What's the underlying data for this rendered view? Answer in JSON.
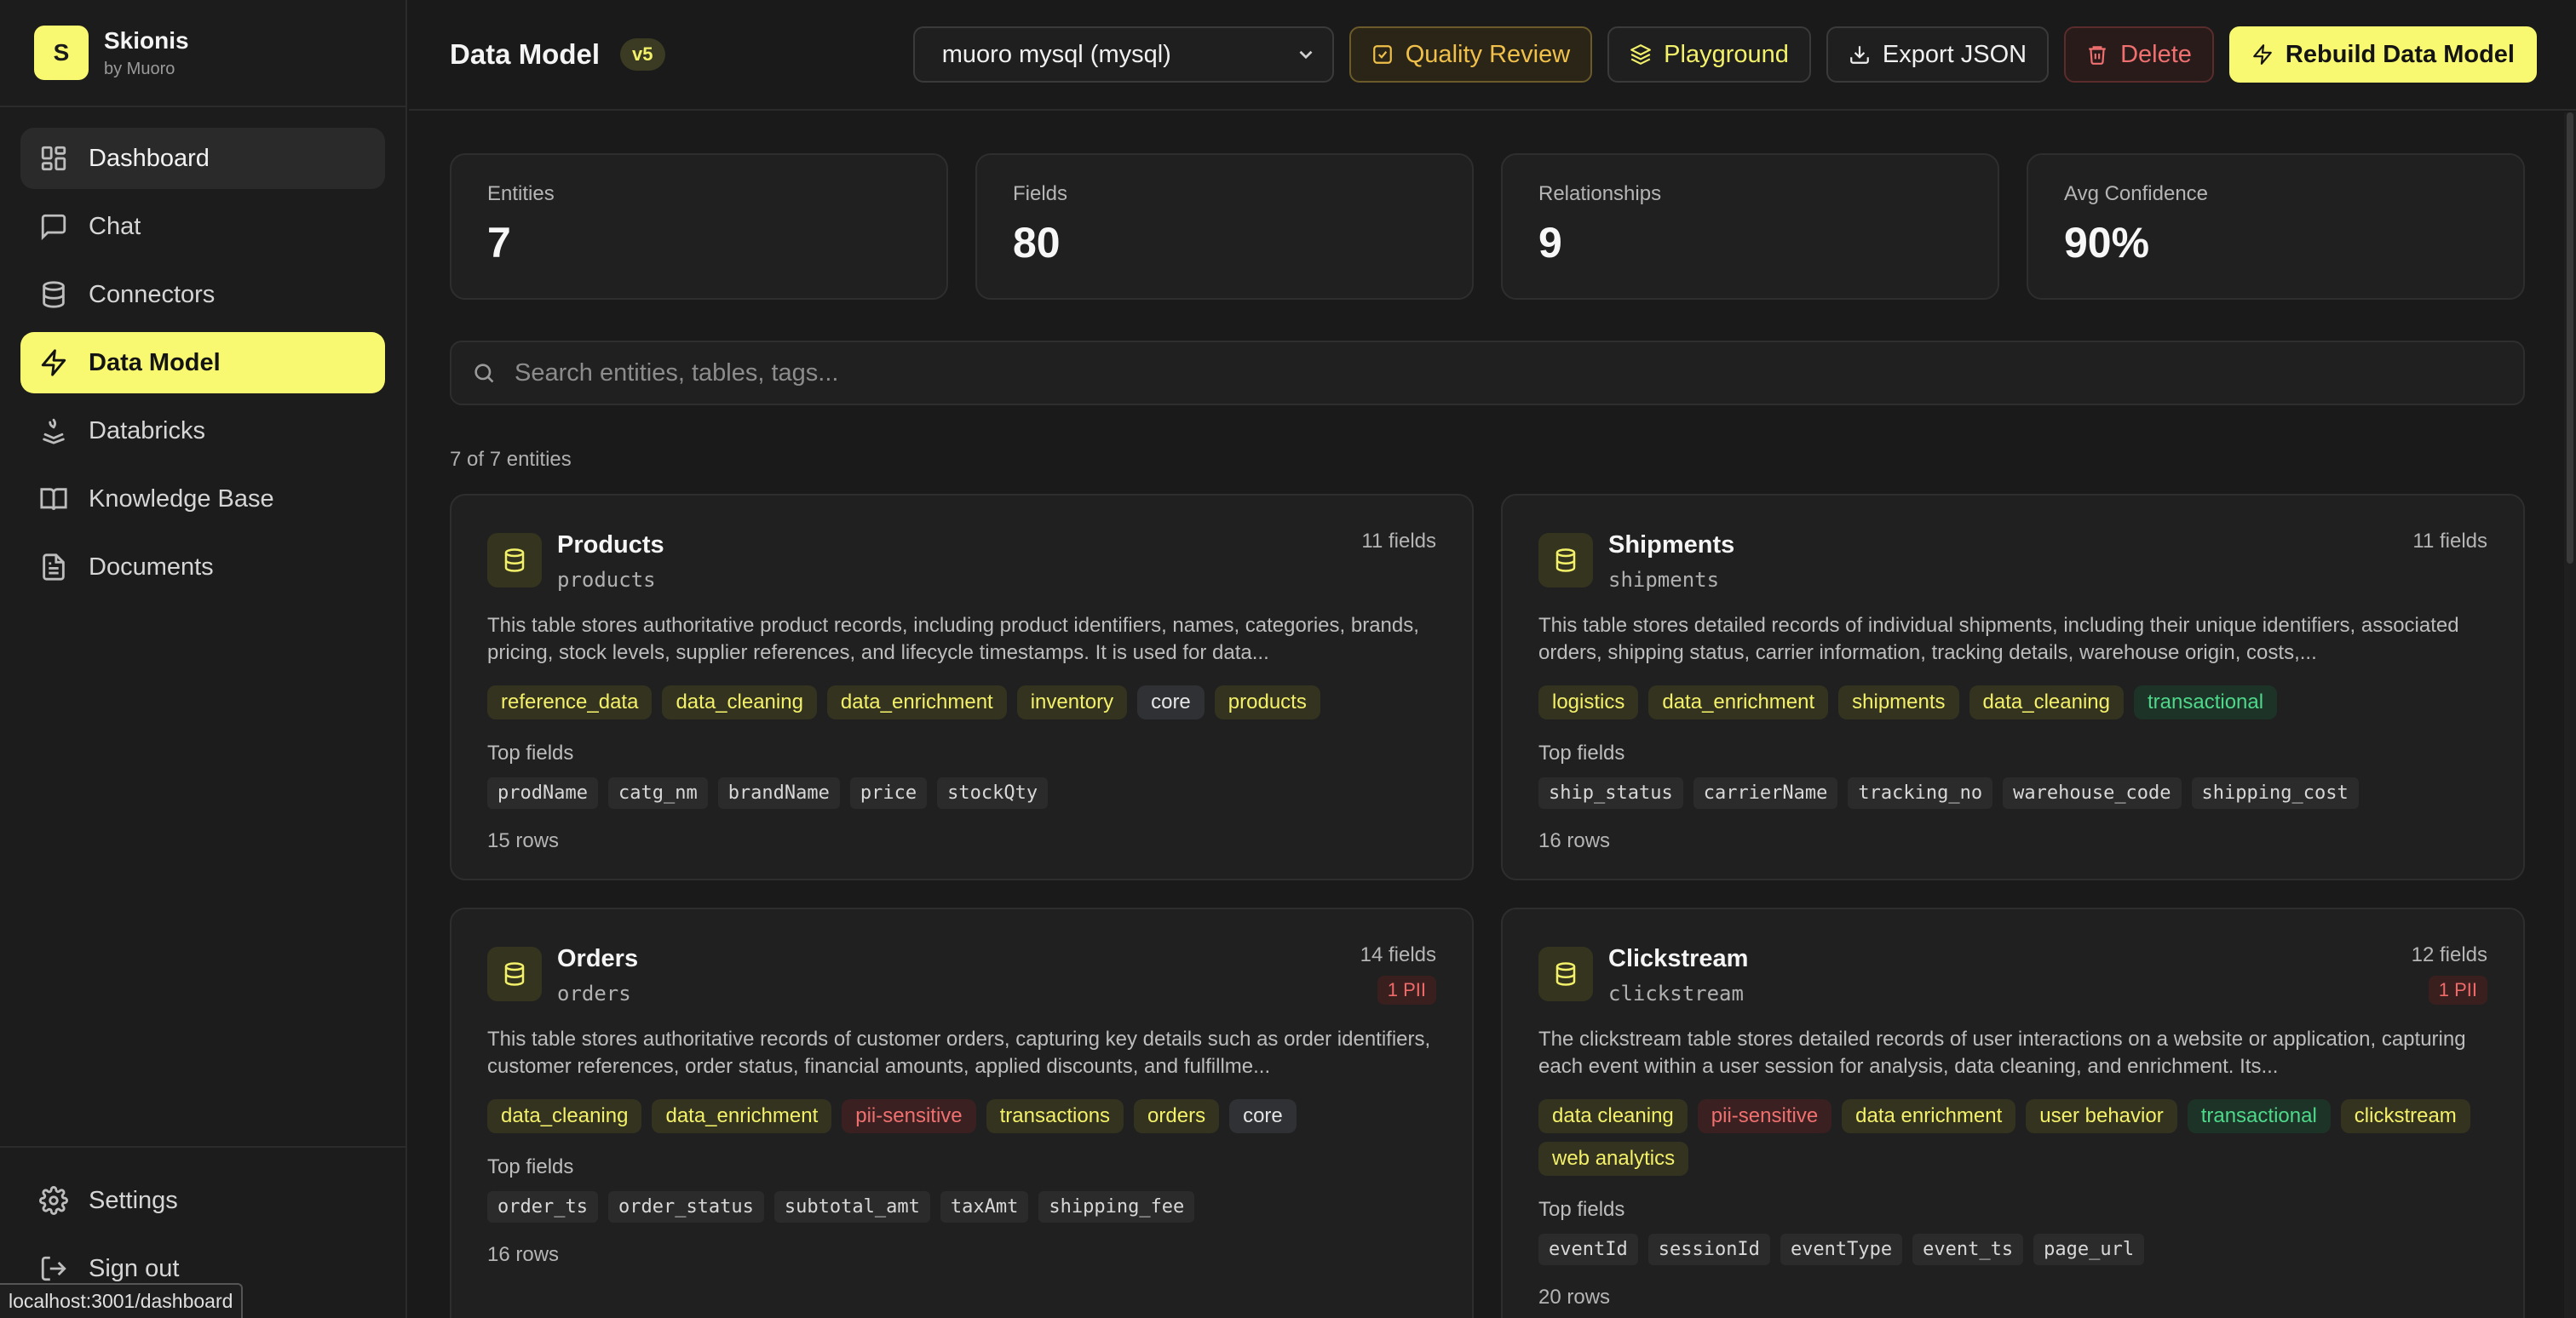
{
  "brand": {
    "logo_letter": "S",
    "name": "Skionis",
    "sub": "by Muoro"
  },
  "nav": [
    {
      "label": "Dashboard",
      "icon": "dashboard-icon"
    },
    {
      "label": "Chat",
      "icon": "chat-icon"
    },
    {
      "label": "Connectors",
      "icon": "database-icon"
    },
    {
      "label": "Data Model",
      "icon": "bolt-icon"
    },
    {
      "label": "Databricks",
      "icon": "databricks-icon"
    },
    {
      "label": "Knowledge Base",
      "icon": "book-icon"
    },
    {
      "label": "Documents",
      "icon": "document-icon"
    }
  ],
  "nav_bottom": [
    {
      "label": "Settings",
      "icon": "gear-icon"
    },
    {
      "label": "Sign out",
      "icon": "sign-out-icon"
    }
  ],
  "status_url": "localhost:3001/dashboard",
  "header": {
    "title": "Data Model",
    "version": "v5",
    "connection": "muoro mysql (mysql)",
    "buttons": {
      "quality": "Quality Review",
      "playground": "Playground",
      "export": "Export JSON",
      "delete": "Delete",
      "rebuild": "Rebuild Data Model"
    }
  },
  "stats": [
    {
      "label": "Entities",
      "value": "7"
    },
    {
      "label": "Fields",
      "value": "80"
    },
    {
      "label": "Relationships",
      "value": "9"
    },
    {
      "label": "Avg Confidence",
      "value": "90%"
    }
  ],
  "search": {
    "placeholder": "Search entities, tables, tags..."
  },
  "entity_count": "7 of 7 entities",
  "labels": {
    "top_fields": "Top fields"
  },
  "cards": [
    {
      "title": "Products",
      "table": "products",
      "fields_count": "11 fields",
      "pii": "",
      "description": "This table stores authoritative product records, including product identifiers, names, categories, brands, pricing, stock levels, supplier references, and lifecycle timestamps. It is used for data...",
      "tags": [
        {
          "text": "reference_data",
          "tone": "yellow"
        },
        {
          "text": "data_cleaning",
          "tone": "yellow"
        },
        {
          "text": "data_enrichment",
          "tone": "yellow"
        },
        {
          "text": "inventory",
          "tone": "yellow"
        },
        {
          "text": "core",
          "tone": "neutral"
        },
        {
          "text": "products",
          "tone": "yellow"
        }
      ],
      "top_fields": [
        "prodName",
        "catg_nm",
        "brandName",
        "price",
        "stockQty"
      ],
      "rows": "15 rows"
    },
    {
      "title": "Shipments",
      "table": "shipments",
      "fields_count": "11 fields",
      "pii": "",
      "description": "This table stores detailed records of individual shipments, including their unique identifiers, associated orders, shipping status, carrier information, tracking details, warehouse origin, costs,...",
      "tags": [
        {
          "text": "logistics",
          "tone": "yellow"
        },
        {
          "text": "data_enrichment",
          "tone": "yellow"
        },
        {
          "text": "shipments",
          "tone": "yellow"
        },
        {
          "text": "data_cleaning",
          "tone": "yellow"
        },
        {
          "text": "transactional",
          "tone": "green"
        }
      ],
      "top_fields": [
        "ship_status",
        "carrierName",
        "tracking_no",
        "warehouse_code",
        "shipping_cost"
      ],
      "rows": "16 rows"
    },
    {
      "title": "Orders",
      "table": "orders",
      "fields_count": "14 fields",
      "pii": "1 PII",
      "description": "This table stores authoritative records of customer orders, capturing key details such as order identifiers, customer references, order status, financial amounts, applied discounts, and fulfillme...",
      "tags": [
        {
          "text": "data_cleaning",
          "tone": "yellow"
        },
        {
          "text": "data_enrichment",
          "tone": "yellow"
        },
        {
          "text": "pii-sensitive",
          "tone": "red"
        },
        {
          "text": "transactions",
          "tone": "yellow"
        },
        {
          "text": "orders",
          "tone": "yellow"
        },
        {
          "text": "core",
          "tone": "neutral"
        }
      ],
      "top_fields": [
        "order_ts",
        "order_status",
        "subtotal_amt",
        "taxAmt",
        "shipping_fee"
      ],
      "rows": "16 rows"
    },
    {
      "title": "Clickstream",
      "table": "clickstream",
      "fields_count": "12 fields",
      "pii": "1 PII",
      "description": "The clickstream table stores detailed records of user interactions on a website or application, capturing each event within a user session for analysis, data cleaning, and enrichment. Its...",
      "tags": [
        {
          "text": "data cleaning",
          "tone": "yellow"
        },
        {
          "text": "pii-sensitive",
          "tone": "red"
        },
        {
          "text": "data enrichment",
          "tone": "yellow"
        },
        {
          "text": "user behavior",
          "tone": "yellow"
        },
        {
          "text": "transactional",
          "tone": "green"
        },
        {
          "text": "clickstream",
          "tone": "yellow"
        },
        {
          "text": "web analytics",
          "tone": "yellow"
        }
      ],
      "top_fields": [
        "eventId",
        "sessionId",
        "eventType",
        "event_ts",
        "page_url"
      ],
      "rows": "20 rows"
    }
  ],
  "colors": {
    "accent": "#f9f871",
    "background": "#1a1a1a",
    "danger": "#f07070",
    "success": "#4ed88a",
    "warning": "#f0c04a"
  }
}
